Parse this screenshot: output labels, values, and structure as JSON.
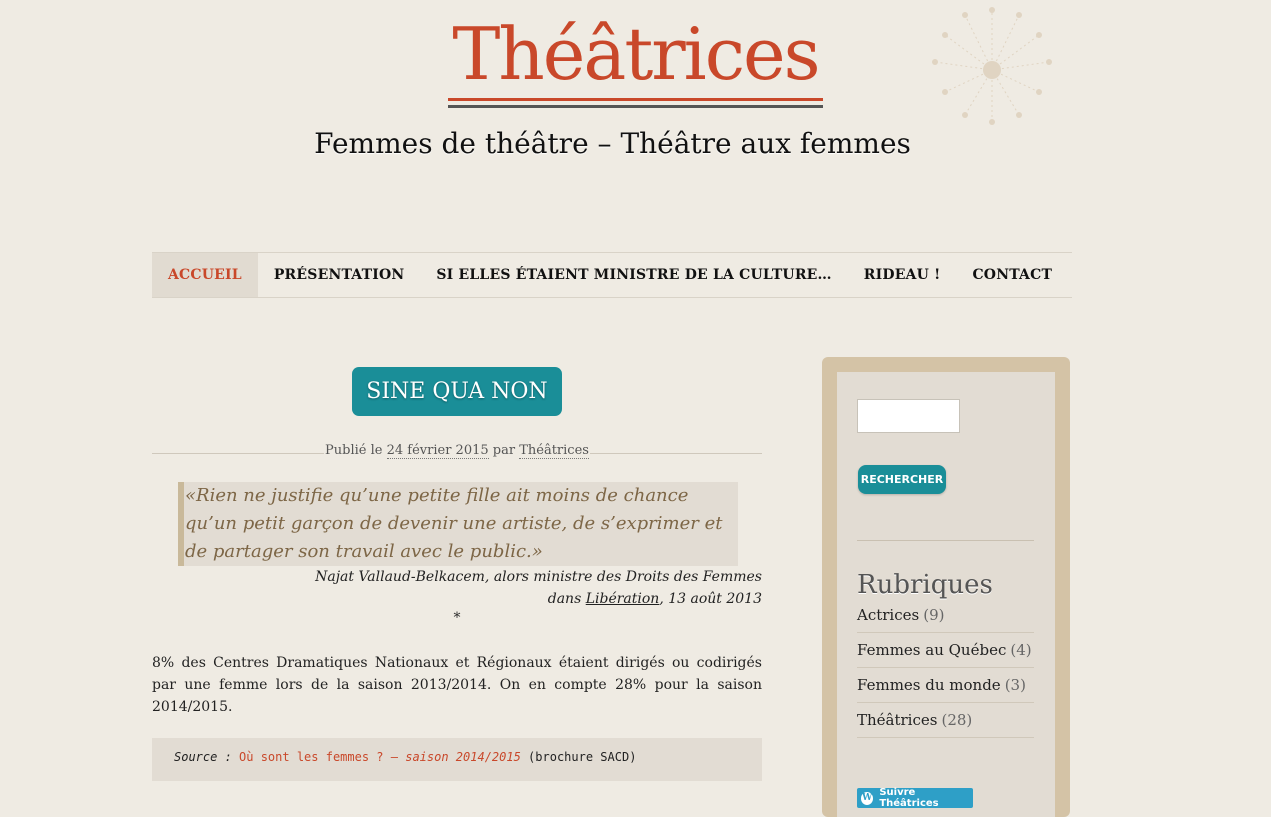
{
  "site": {
    "title": "Théâtrices",
    "tagline": "Femmes de théâtre – Théâtre aux femmes"
  },
  "nav": {
    "items": [
      {
        "label": "ACCUEIL",
        "active": true
      },
      {
        "label": "PRÉSENTATION"
      },
      {
        "label": "SI ELLES ÉTAIENT MINISTRE DE LA CULTURE…"
      },
      {
        "label": "RIDEAU !"
      },
      {
        "label": "CONTACT"
      }
    ]
  },
  "post": {
    "title": "SINE QUA NON",
    "meta_prefix": "Publié le",
    "date": "24 février 2015",
    "meta_by": "par",
    "author": "Théâtrices",
    "quote": "«Rien ne justifie qu’une petite fille ait moins de chance qu’un petit garçon de devenir une artiste, de s’exprimer et de partager son travail avec le public.»",
    "attribution_line1": "Najat Vallaud-Belkacem, alors ministre des Droits des Femmes",
    "attribution_dans": "dans",
    "attribution_source": "Libération",
    "attribution_date": ", 13 août 2013",
    "separator": "*",
    "paragraph": "8% des Centres Dramatiques Nationaux et Régionaux étaient dirigés ou codirigés par une femme lors de la saison 2013/2014. On en compte 28% pour la saison 2014/2015.",
    "source_label": "Source :",
    "source_link_text": "Où sont les femmes ? –",
    "source_link_italic": "saison 2014/2015",
    "source_suffix": "(brochure SACD)"
  },
  "sidebar": {
    "search_placeholder": "",
    "search_button": "RECHERCHER",
    "widget_title": "Rubriques",
    "categories": [
      {
        "name": "Actrices",
        "count": "(9)"
      },
      {
        "name": "Femmes au Québec",
        "count": "(4)"
      },
      {
        "name": "Femmes du monde",
        "count": "(3)"
      },
      {
        "name": "Théâtrices",
        "count": "(28)"
      }
    ],
    "follow_label": "Suivre Théâtrices"
  },
  "colors": {
    "accent": "#c9482a",
    "teal": "#1a8e98",
    "background": "#efebe3",
    "sidebar_frame": "#d4c3a6"
  }
}
